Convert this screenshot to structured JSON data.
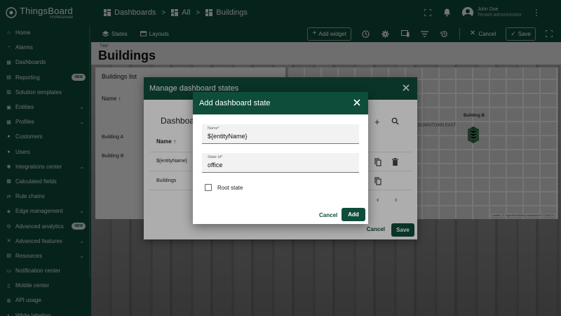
{
  "app": {
    "logo_name": "ThingsBoard",
    "logo_sub": "Professional"
  },
  "breadcrumb": {
    "items": [
      "Dashboards",
      "All",
      "Buildings"
    ],
    "separator": ">"
  },
  "user": {
    "name": "John Doe",
    "role": "Tenant administrator"
  },
  "sidebar": {
    "items": [
      {
        "label": "Home",
        "icon": "home-icon"
      },
      {
        "label": "Alarms",
        "icon": "alarm-icon"
      },
      {
        "label": "Dashboards",
        "icon": "dashboard-icon"
      },
      {
        "label": "Reporting",
        "icon": "report-icon",
        "badge": "NEW"
      },
      {
        "label": "Solution templates",
        "icon": "templates-icon"
      },
      {
        "label": "Entities",
        "icon": "entities-icon",
        "expandable": true
      },
      {
        "label": "Profiles",
        "icon": "profiles-icon",
        "expandable": true
      },
      {
        "label": "Customers",
        "icon": "customers-icon"
      },
      {
        "label": "Users",
        "icon": "users-icon"
      },
      {
        "label": "Integrations center",
        "icon": "integrations-icon",
        "expandable": true
      },
      {
        "label": "Calculated fields",
        "icon": "calculated-icon"
      },
      {
        "label": "Rule chains",
        "icon": "rule-chains-icon"
      },
      {
        "label": "Edge management",
        "icon": "edge-icon",
        "expandable": true
      },
      {
        "label": "Advanced analytics",
        "icon": "analytics-icon",
        "badge": "NEW"
      },
      {
        "label": "Advanced features",
        "icon": "features-icon",
        "expandable": true
      },
      {
        "label": "Resources",
        "icon": "resources-icon",
        "expandable": true
      },
      {
        "label": "Notification center",
        "icon": "notification-icon"
      },
      {
        "label": "Mobile center",
        "icon": "mobile-icon"
      },
      {
        "label": "API usage",
        "icon": "api-icon"
      },
      {
        "label": "White labeling",
        "icon": "white-label-icon"
      }
    ]
  },
  "toolbar": {
    "states_label": "States",
    "layouts_label": "Layouts",
    "add_widget_label": "Add widget",
    "cancel_label": "Cancel",
    "save_label": "Save"
  },
  "dashboard": {
    "title_label": "Title*",
    "title": "Buildings",
    "buildings_list": {
      "title": "Buildings list",
      "header": "Name",
      "rows": [
        "Building A",
        "Building B"
      ]
    },
    "map": {
      "marker_label": "Building B",
      "area_label": "DOWNTOWN EAST",
      "attribution": "Leaflet | © OpenStreetMap contributors © CARTO"
    }
  },
  "manage_dialog": {
    "title": "Manage dashboard states",
    "section_title": "Dashboard states",
    "header_name": "Name",
    "rows": [
      "${entityName}",
      "Buildings"
    ],
    "cancel_label": "Cancel",
    "save_label": "Save"
  },
  "add_dialog": {
    "title": "Add dashboard state",
    "name_label": "Name*",
    "name_value": "${entityName}",
    "state_id_label": "State Id*",
    "state_id_value": "office",
    "root_state_label": "Root state",
    "root_state_checked": false,
    "cancel_label": "Cancel",
    "add_label": "Add"
  },
  "colors": {
    "primary": "#0f4d3b"
  }
}
